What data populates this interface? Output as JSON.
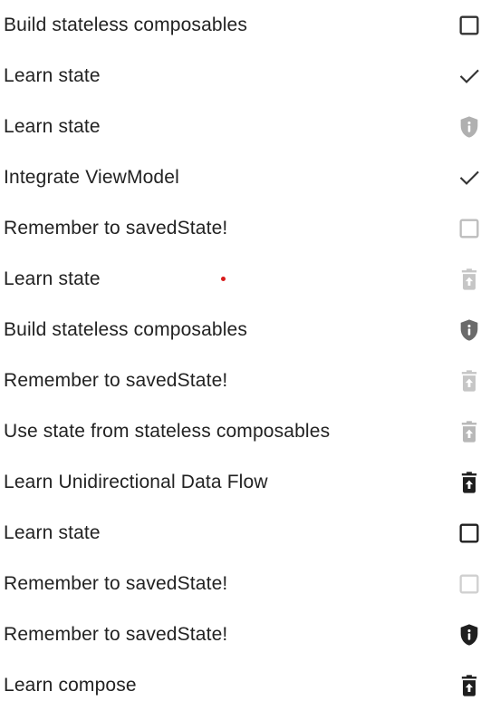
{
  "tasks": [
    {
      "label": "Build stateless composables",
      "icon": "checkbox-outline-icon",
      "color": "#333333"
    },
    {
      "label": "Learn state",
      "icon": "check-icon",
      "color": "#333333"
    },
    {
      "label": "Learn state",
      "icon": "shield-info-icon",
      "color": "#b0b0b0"
    },
    {
      "label": "Integrate ViewModel",
      "icon": "check-icon",
      "color": "#333333"
    },
    {
      "label": "Remember to savedState!",
      "icon": "checkbox-outline-icon",
      "color": "#bdbdbd"
    },
    {
      "label": "Learn state",
      "icon": "delete-restore-icon",
      "color": "#c6c6c6"
    },
    {
      "label": "Build stateless composables",
      "icon": "shield-info-icon",
      "color": "#6b6b6b"
    },
    {
      "label": "Remember to savedState!",
      "icon": "delete-restore-icon",
      "color": "#c6c6c6"
    },
    {
      "label": "Use state from stateless composables",
      "icon": "delete-restore-icon",
      "color": "#b8b8b8"
    },
    {
      "label": "Learn Unidirectional Data Flow",
      "icon": "delete-restore-icon",
      "color": "#1f1f1f"
    },
    {
      "label": "Learn state",
      "icon": "checkbox-outline-icon",
      "color": "#1f1f1f"
    },
    {
      "label": "Remember to savedState!",
      "icon": "checkbox-outline-icon",
      "color": "#d0d0d0"
    },
    {
      "label": "Remember to savedState!",
      "icon": "shield-info-icon",
      "color": "#1f1f1f"
    },
    {
      "label": "Learn compose",
      "icon": "delete-restore-icon",
      "color": "#1f1f1f"
    }
  ]
}
